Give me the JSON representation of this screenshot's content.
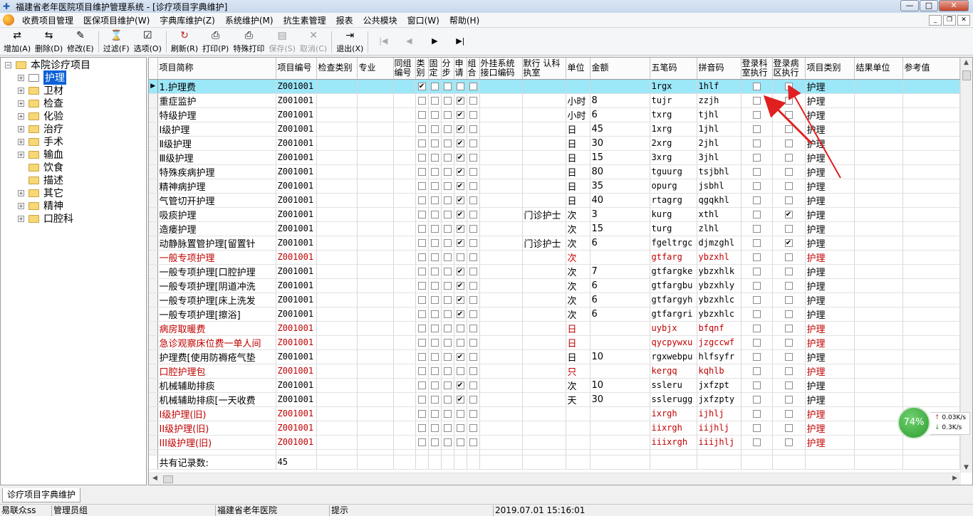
{
  "window": {
    "title": "福建省老年医院项目维护管理系统 - [诊疗项目字典维护]"
  },
  "menu": [
    "收费项目管理",
    "医保项目维护(W)",
    "字典库维护(Z)",
    "系统维护(M)",
    "抗生素管理",
    "报表",
    "公共模块",
    "窗口(W)",
    "帮助(H)"
  ],
  "toolbar": {
    "add": "增加(A)",
    "delete": "删除(D)",
    "modify": "修改(E)",
    "filter": "过滤(F)",
    "options": "选项(O)",
    "refresh": "刷新(R)",
    "print": "打印(P)",
    "special_print": "特殊打印",
    "save": "保存(S)",
    "cancel": "取消(C)",
    "exit": "退出(X)"
  },
  "tree": {
    "root": "本院诊疗项目",
    "items": [
      "护理",
      "卫材",
      "检查",
      "化验",
      "治疗",
      "手术",
      "输血",
      "饮食",
      "描述",
      "其它",
      "精神",
      "口腔科"
    ],
    "selected": "护理"
  },
  "grid": {
    "columns": [
      "项目简称",
      "项目编号",
      "检查类别",
      "专业",
      "同组编号",
      "类别",
      "固定",
      "分步",
      "申请",
      "组合",
      "外挂系统接口编码",
      "默行 认科 执室",
      "单位",
      "金额",
      "五笔码",
      "拼音码",
      "登录科室执行",
      "登录病区执行",
      "项目类别",
      "结果单位",
      "参考值"
    ],
    "rows": [
      {
        "name": "1.护理费",
        "code": "Z001001",
        "exec": "",
        "unit": "",
        "amount": "",
        "wubi": "1rgx",
        "pinyin": "1hlf",
        "type": "护理",
        "red": false,
        "sel": true,
        "c1": true,
        "c4": false,
        "ward": false
      },
      {
        "name": "重症监护",
        "code": "Z001001",
        "exec": "",
        "unit": "小时",
        "amount": "8",
        "wubi": "tujr",
        "pinyin": "zzjh",
        "type": "护理",
        "red": false,
        "sel": false,
        "c1": false,
        "c4": true,
        "ward": false
      },
      {
        "name": "特级护理",
        "code": "Z001001",
        "exec": "",
        "unit": "小时",
        "amount": "6",
        "wubi": "txrg",
        "pinyin": "tjhl",
        "type": "护理",
        "red": false,
        "sel": false,
        "c1": false,
        "c4": true,
        "ward": false
      },
      {
        "name": "Ⅰ级护理",
        "code": "Z001001",
        "exec": "",
        "unit": "日",
        "amount": "45",
        "wubi": "1xrg",
        "pinyin": "1jhl",
        "type": "护理",
        "red": false,
        "sel": false,
        "c1": false,
        "c4": true,
        "ward": false
      },
      {
        "name": "Ⅱ级护理",
        "code": "Z001001",
        "exec": "",
        "unit": "日",
        "amount": "30",
        "wubi": "2xrg",
        "pinyin": "2jhl",
        "type": "护理",
        "red": false,
        "sel": false,
        "c1": false,
        "c4": true,
        "ward": false
      },
      {
        "name": "Ⅲ级护理",
        "code": "Z001001",
        "exec": "",
        "unit": "日",
        "amount": "15",
        "wubi": "3xrg",
        "pinyin": "3jhl",
        "type": "护理",
        "red": false,
        "sel": false,
        "c1": false,
        "c4": true,
        "ward": false
      },
      {
        "name": "特殊疾病护理",
        "code": "Z001001",
        "exec": "",
        "unit": "日",
        "amount": "80",
        "wubi": "tguurg",
        "pinyin": "tsjbhl",
        "type": "护理",
        "red": false,
        "sel": false,
        "c1": false,
        "c4": true,
        "ward": false
      },
      {
        "name": "精神病护理",
        "code": "Z001001",
        "exec": "",
        "unit": "日",
        "amount": "35",
        "wubi": "opurg",
        "pinyin": "jsbhl",
        "type": "护理",
        "red": false,
        "sel": false,
        "c1": false,
        "c4": true,
        "ward": false
      },
      {
        "name": "气管切开护理",
        "code": "Z001001",
        "exec": "",
        "unit": "日",
        "amount": "40",
        "wubi": "rtagrg",
        "pinyin": "qgqkhl",
        "type": "护理",
        "red": false,
        "sel": false,
        "c1": false,
        "c4": true,
        "ward": false
      },
      {
        "name": "吸痰护理",
        "code": "Z001001",
        "exec": "门诊护士",
        "unit": "次",
        "amount": "3",
        "wubi": "kurg",
        "pinyin": "xthl",
        "type": "护理",
        "red": false,
        "sel": false,
        "c1": false,
        "c4": true,
        "ward": true
      },
      {
        "name": "造瘘护理",
        "code": "Z001001",
        "exec": "",
        "unit": "次",
        "amount": "15",
        "wubi": "turg",
        "pinyin": "zlhl",
        "type": "护理",
        "red": false,
        "sel": false,
        "c1": false,
        "c4": true,
        "ward": false
      },
      {
        "name": "动静脉置管护理[留置针",
        "code": "Z001001",
        "exec": "门诊护士",
        "unit": "次",
        "amount": "6",
        "wubi": "fgeltrgc",
        "pinyin": "djmzghl",
        "type": "护理",
        "red": false,
        "sel": false,
        "c1": false,
        "c4": true,
        "ward": true
      },
      {
        "name": "一般专项护理",
        "code": "Z001001",
        "exec": "",
        "unit": "次",
        "amount": "",
        "wubi": "gtfarg",
        "pinyin": "ybzxhl",
        "type": "护理",
        "red": true,
        "sel": false,
        "c1": false,
        "c4": false,
        "ward": false
      },
      {
        "name": "一般专项护理[口腔护理",
        "code": "Z001001",
        "exec": "",
        "unit": "次",
        "amount": "7",
        "wubi": "gtfargke",
        "pinyin": "ybzxhlk",
        "type": "护理",
        "red": false,
        "sel": false,
        "c1": false,
        "c4": true,
        "ward": false
      },
      {
        "name": "一般专项护理[阴道冲洗",
        "code": "Z001001",
        "exec": "",
        "unit": "次",
        "amount": "6",
        "wubi": "gtfargbu",
        "pinyin": "ybzxhly",
        "type": "护理",
        "red": false,
        "sel": false,
        "c1": false,
        "c4": true,
        "ward": false
      },
      {
        "name": "一般专项护理[床上洗发",
        "code": "Z001001",
        "exec": "",
        "unit": "次",
        "amount": "6",
        "wubi": "gtfargyh",
        "pinyin": "ybzxhlc",
        "type": "护理",
        "red": false,
        "sel": false,
        "c1": false,
        "c4": true,
        "ward": false
      },
      {
        "name": "一般专项护理[擦浴]",
        "code": "Z001001",
        "exec": "",
        "unit": "次",
        "amount": "6",
        "wubi": "gtfargri",
        "pinyin": "ybzxhlc",
        "type": "护理",
        "red": false,
        "sel": false,
        "c1": false,
        "c4": true,
        "ward": false
      },
      {
        "name": "病房取暖费",
        "code": "Z001001",
        "exec": "",
        "unit": "日",
        "amount": "",
        "wubi": "uybjx",
        "pinyin": "bfqnf",
        "type": "护理",
        "red": true,
        "sel": false,
        "c1": false,
        "c4": false,
        "ward": false
      },
      {
        "name": "急诊观察床位费一单人间",
        "code": "Z001001",
        "exec": "",
        "unit": "日",
        "amount": "",
        "wubi": "qycpywxu",
        "pinyin": "jzgccwf",
        "type": "护理",
        "red": true,
        "sel": false,
        "c1": false,
        "c4": false,
        "ward": false
      },
      {
        "name": "护理费[使用防褥疮气垫",
        "code": "Z001001",
        "exec": "",
        "unit": "日",
        "amount": "10",
        "wubi": "rgxwebpu",
        "pinyin": "hlfsyfr",
        "type": "护理",
        "red": false,
        "sel": false,
        "c1": false,
        "c4": true,
        "ward": false
      },
      {
        "name": "口腔护理包",
        "code": "Z001001",
        "exec": "",
        "unit": "只",
        "amount": "",
        "wubi": "kergq",
        "pinyin": "kqhlb",
        "type": "护理",
        "red": true,
        "sel": false,
        "c1": false,
        "c4": false,
        "ward": false
      },
      {
        "name": "机械辅助排痰",
        "code": "Z001001",
        "exec": "",
        "unit": "次",
        "amount": "10",
        "wubi": "ssleru",
        "pinyin": "jxfzpt",
        "type": "护理",
        "red": false,
        "sel": false,
        "c1": false,
        "c4": true,
        "ward": false
      },
      {
        "name": "机械辅助排痰[一天收费",
        "code": "Z001001",
        "exec": "",
        "unit": "天",
        "amount": "30",
        "wubi": "sslerugg",
        "pinyin": "jxfzpty",
        "type": "护理",
        "red": false,
        "sel": false,
        "c1": false,
        "c4": true,
        "ward": false
      },
      {
        "name": "I级护理(旧)",
        "code": "Z001001",
        "exec": "",
        "unit": "",
        "amount": "",
        "wubi": "ixrgh",
        "pinyin": "ijhlj",
        "type": "护理",
        "red": true,
        "sel": false,
        "c1": false,
        "c4": false,
        "ward": false
      },
      {
        "name": "II级护理(旧)",
        "code": "Z001001",
        "exec": "",
        "unit": "",
        "amount": "",
        "wubi": "iixrgh",
        "pinyin": "iijhlj",
        "type": "护理",
        "red": true,
        "sel": false,
        "c1": false,
        "c4": false,
        "ward": false
      },
      {
        "name": "III级护理(旧)",
        "code": "Z001001",
        "exec": "",
        "unit": "",
        "amount": "",
        "wubi": "iiixrgh",
        "pinyin": "iiijhlj",
        "type": "护理",
        "red": true,
        "sel": false,
        "c1": false,
        "c4": false,
        "ward": false
      }
    ],
    "footer_label": "共有记录数:",
    "footer_count": "45"
  },
  "tabs": [
    "诊疗项目字典维护"
  ],
  "status": {
    "user": "易联众ss",
    "group": "管理员组",
    "hospital": "福建省老年医院",
    "hint": "提示",
    "datetime": "2019.07.01  15:16:01"
  },
  "net": {
    "percent": "74%",
    "up": "0.03K/s",
    "down": "0.3K/s"
  },
  "colors": {
    "selected_row": "#9ce7f8",
    "red_text": "#c00000",
    "tree_selected": "#0a60d8",
    "annotation_arrow": "#e02020"
  }
}
